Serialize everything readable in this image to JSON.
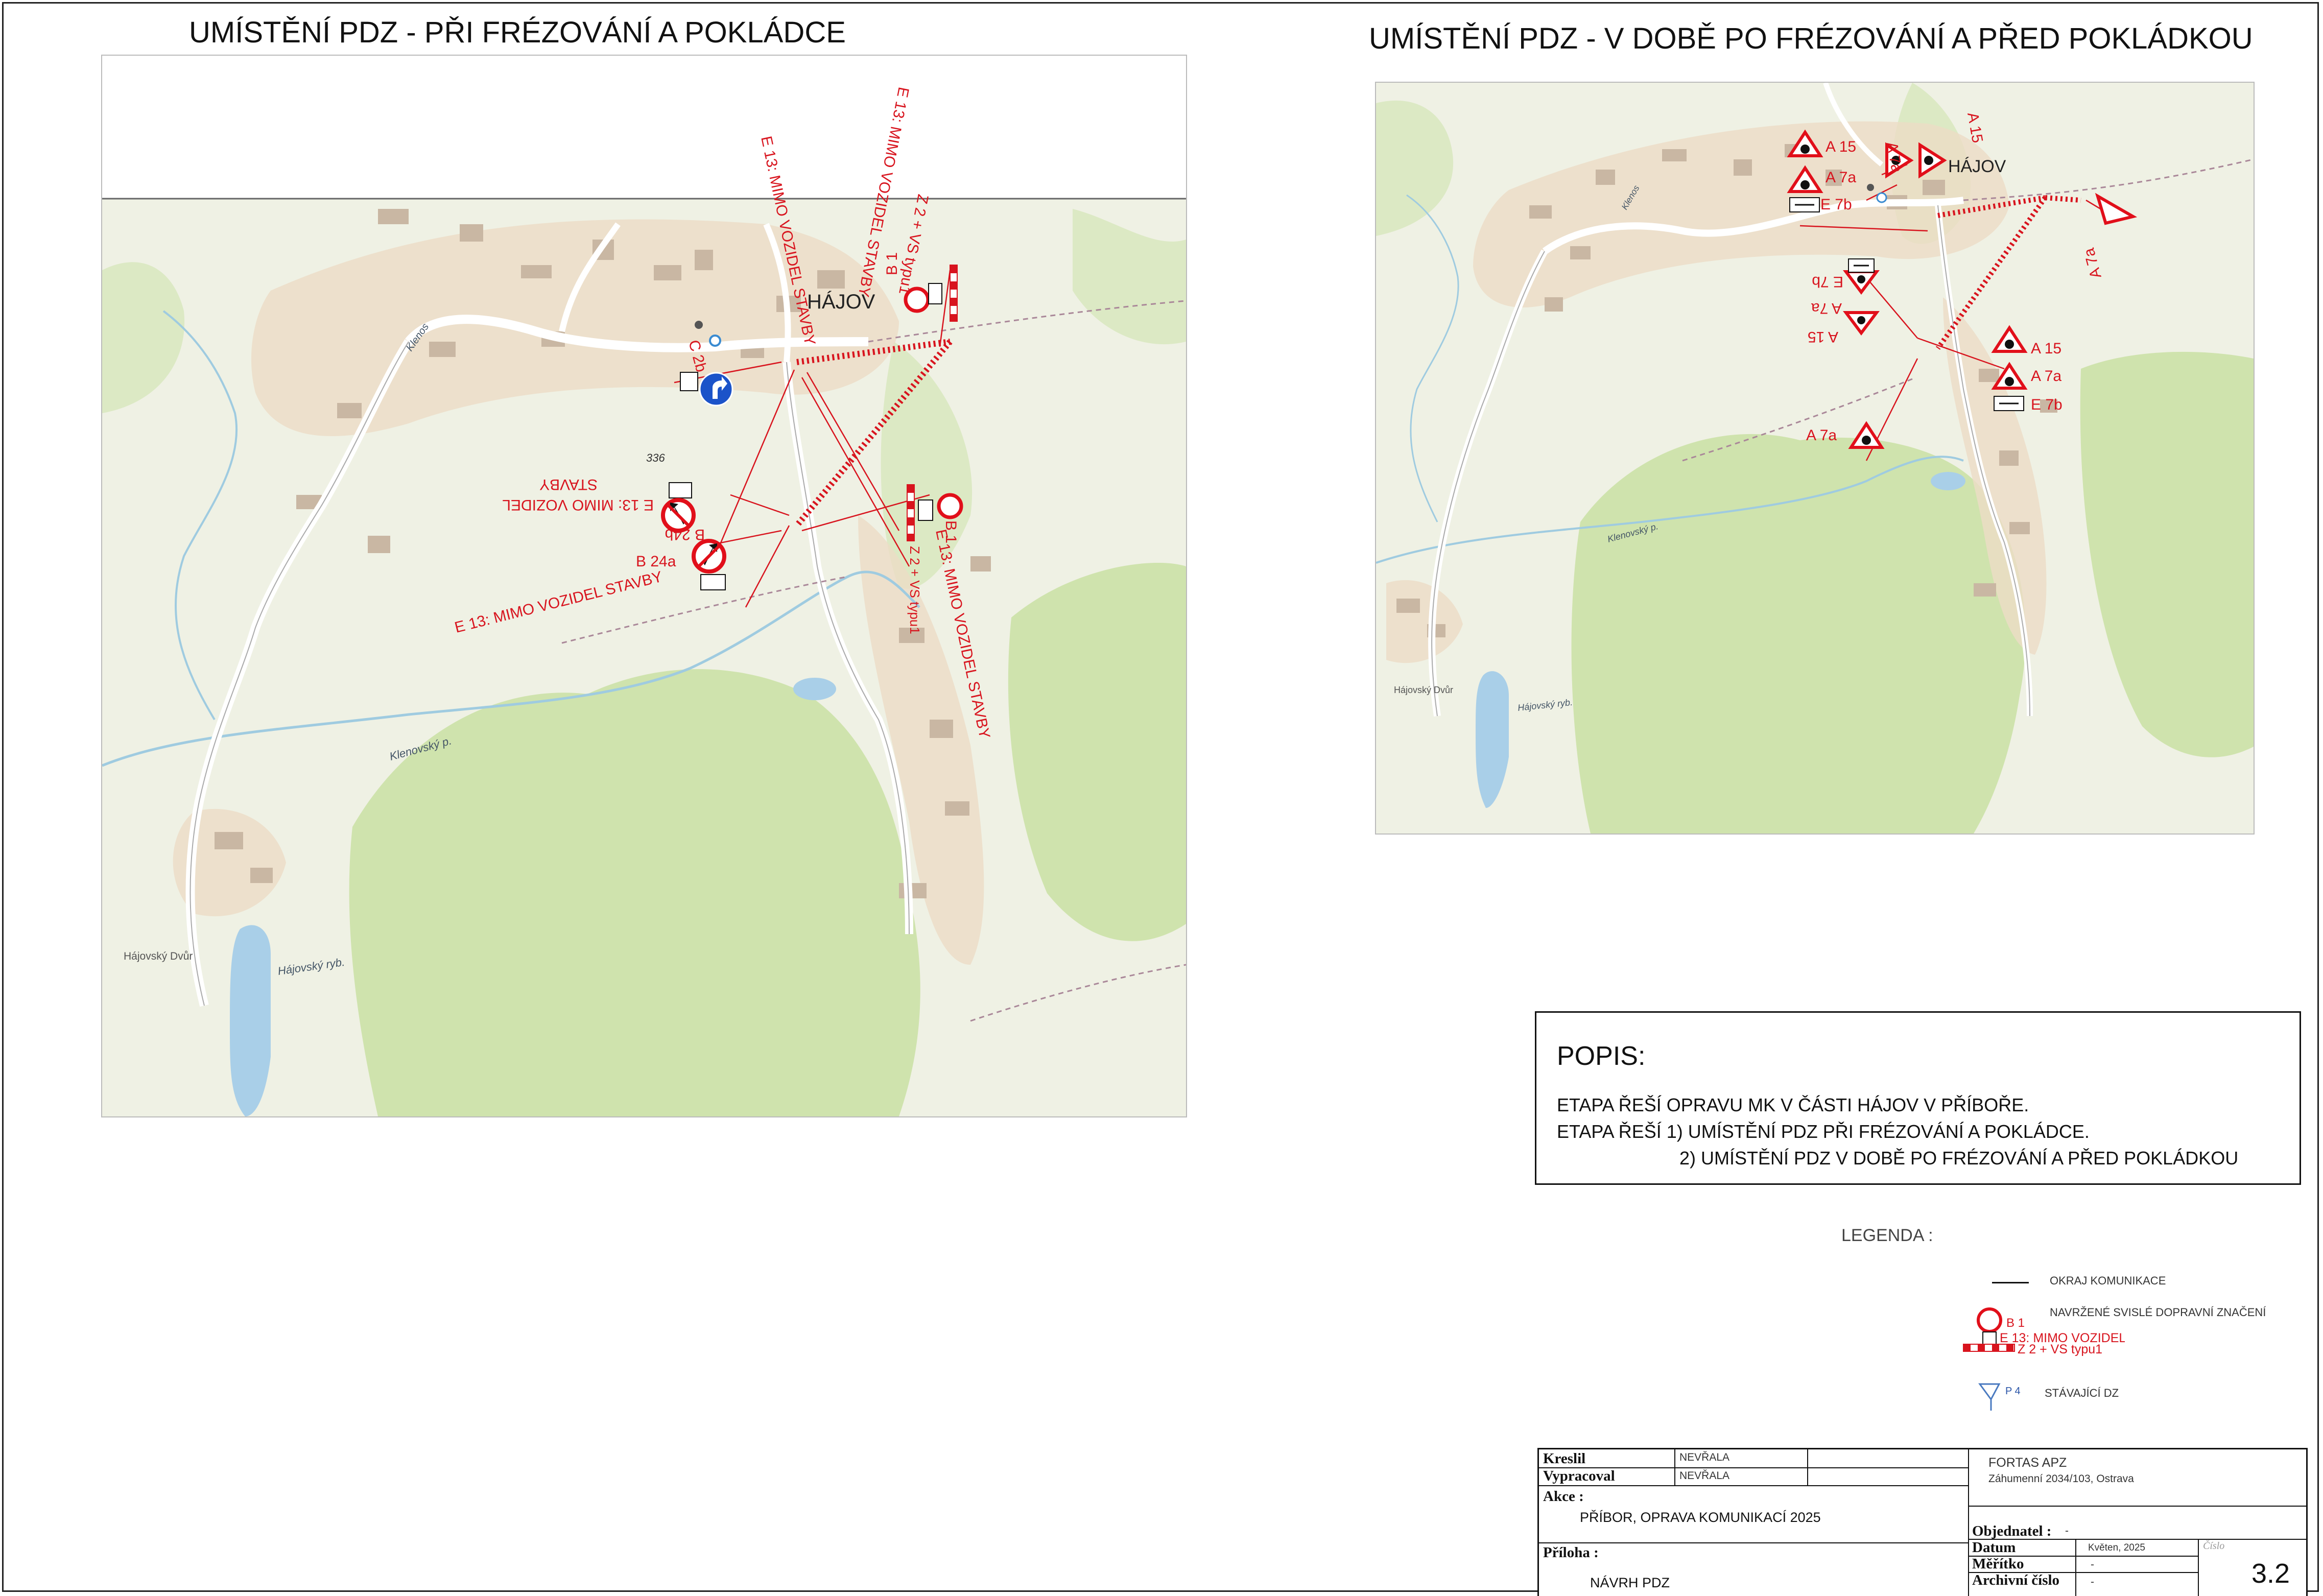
{
  "left_panel": {
    "title": "UMÍSTĚNÍ PDZ - PŘI FRÉZOVÁNÍ A POKLÁDCE",
    "village": "HÁJOV",
    "farm": "Hájovský Dvůr",
    "pond": "Hájovský ryb.",
    "stream": "Klenovský p.",
    "stream2": "Klenos",
    "elevation": "336",
    "labels": {
      "e13_vertical": "E 13: MIMO VOZIDEL STAVBY",
      "e13_rotated_left": "E 13: MIMO VOZIDEL STAVBY",
      "b1_top": "B 1",
      "z2_top": "Z 2 + VS typu1",
      "e13_top": "E 13: MIMO VOZIDEL STAVBY",
      "c2b": "C 2b",
      "b24b": "B 24b",
      "e13_b24b_line1": "E 13: MIMO VOZIDEL",
      "e13_b24b_line2": "STAVBY",
      "b24a": "B 24a",
      "e13_bottom": "E 13: MIMO VOZIDEL STAVBY",
      "b1_right": "B 1",
      "e13_right": "E 13: MIMO VOZIDEL STAVBY",
      "z2_right": "Z 2 + VS typu1"
    }
  },
  "right_panel": {
    "title": "UMÍSTĚNÍ PDZ - V DOBĚ PO FRÉZOVÁNÍ A PŘED POKLÁDKOU",
    "village": "HÁJOV",
    "farm": "Hájovský Dvůr",
    "pond": "Hájovský ryb.",
    "stream": "Klenovský p.",
    "stream2": "Klenos",
    "labels": {
      "a15_1": "A 15",
      "a7a_1": "A 7a",
      "e7b_1": "E 7b",
      "a7a_2": "A 7a",
      "a15_2": "A 15",
      "a7a_3": "A 7a",
      "e7b_2": "E 7b",
      "a7a_4": "A 7a",
      "a15_4": "A 15",
      "e7b_4": "E 7b",
      "a15_5": "A 15",
      "a7a_5": "A 7a",
      "a7a_6": "A 7a"
    }
  },
  "popis": {
    "heading": "POPIS:",
    "line1": "ETAPA ŘEŠÍ OPRAVU MK V ČÁSTI HÁJOV V PŘÍBOŘE.",
    "line2": "ETAPA ŘEŠÍ 1) UMÍSTĚNÍ PDZ PŘI FRÉZOVÁNÍ A POKLÁDCE.",
    "line3": "2) UMÍSTĚNÍ PDZ V DOBĚ PO FRÉZOVÁNÍ A PŘED POKLÁDKOU"
  },
  "legend": {
    "title": "LEGENDA :",
    "okraj": "OKRAJ KOMUNIKACE",
    "navrzene": "NAVRŽENÉ SVISLÉ DOPRAVNÍ ZNAČENÍ",
    "b1": "B 1",
    "e13": "E 13: MIMO VOZIDEL STAVBY",
    "z2": "Z 2 + VS typu1",
    "p4": "P 4",
    "stavajici": "STÁVAJÍCÍ DZ"
  },
  "title_block": {
    "kreslil_label": "Kreslil",
    "kreslil_value": "NEVŘALA",
    "vypracoval_label": "Vypracoval",
    "vypracoval_value": "NEVŘALA",
    "company": "FORTAS APZ",
    "address": "Záhumenní 2034/103, Ostrava",
    "akce_label": "Akce :",
    "akce_value": "PŘÍBOR, OPRAVA KOMUNIKACÍ 2025",
    "objednatel_label": "Objednatel :",
    "objednatel_value": "-",
    "priloha_label": "Příloha :",
    "priloha_value": "NÁVRH PDZ",
    "datum_label": "Datum",
    "datum_value": "Květen, 2025",
    "meritko_label": "Měřítko",
    "meritko_value": "-",
    "archivni_label": "Archivní číslo",
    "archivni_value": "-",
    "cislo_label": "Číslo",
    "cislo_value": "3.2"
  }
}
